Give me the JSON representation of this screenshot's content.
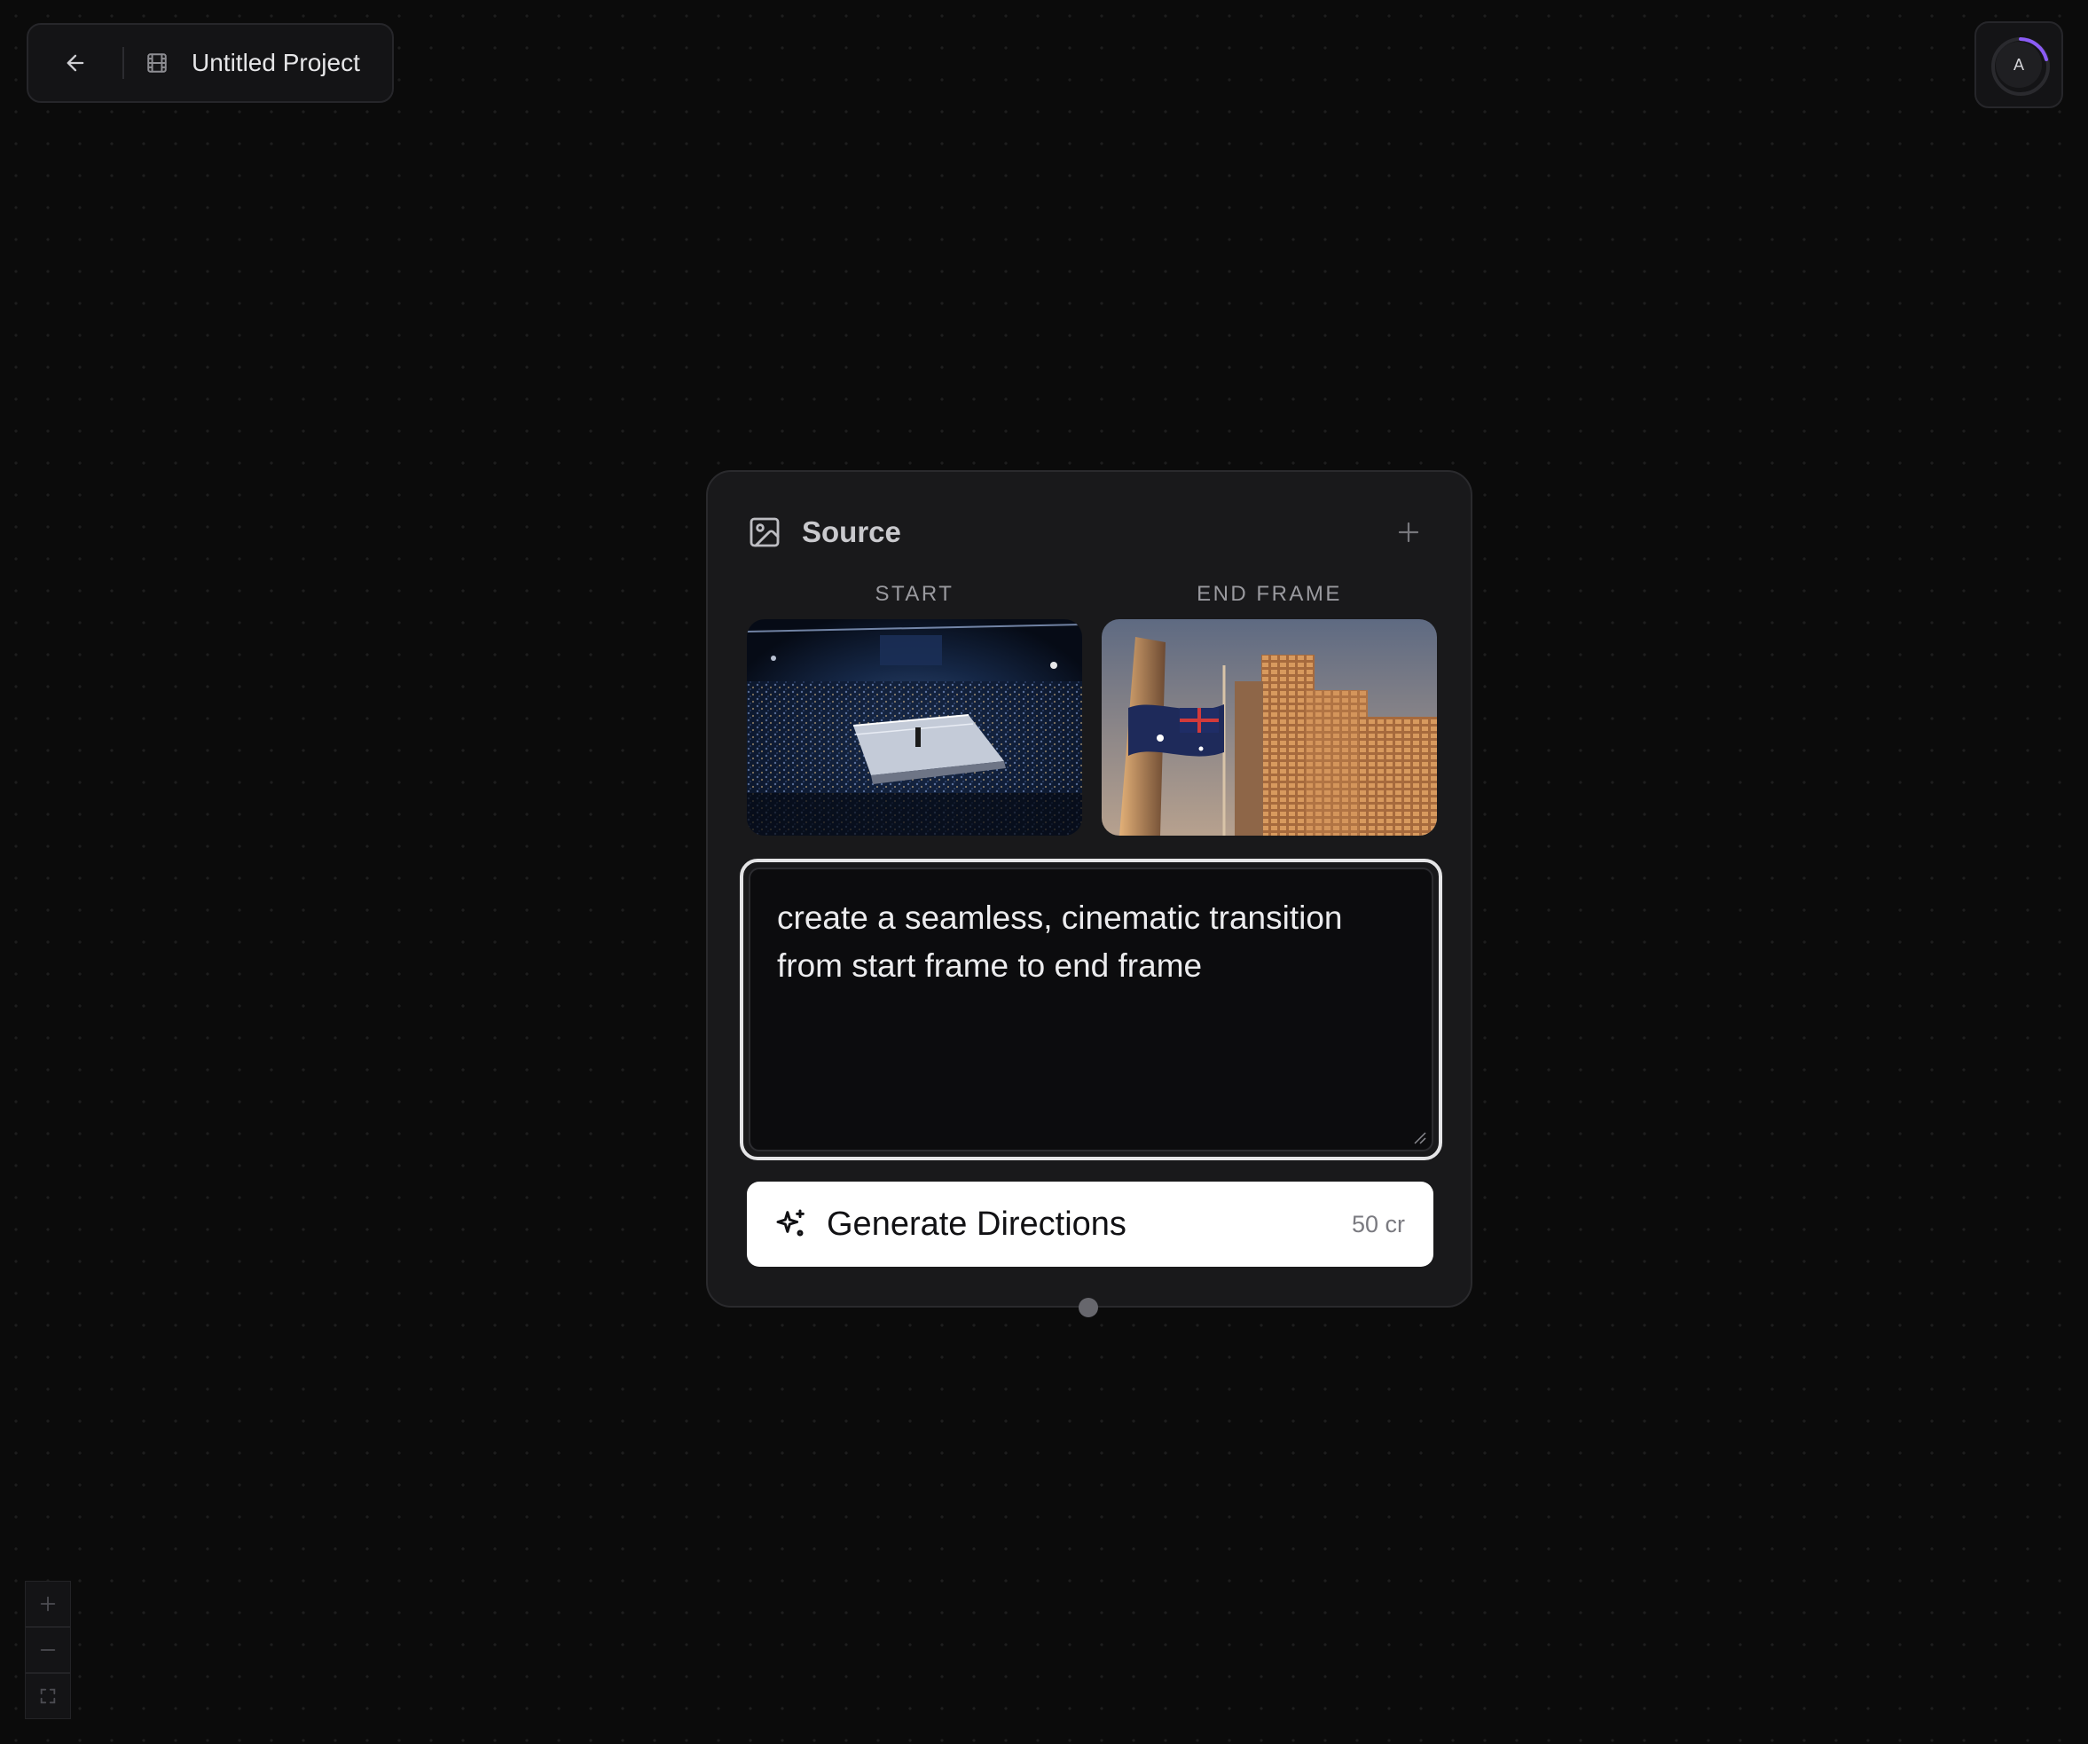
{
  "header": {
    "back_icon": "arrow-left-icon",
    "project_icon": "film-icon",
    "project_title": "Untitled Project"
  },
  "account": {
    "avatar_letter": "A",
    "progress_ring_color": "#8b5cf6"
  },
  "source_node": {
    "icon": "image-icon",
    "title": "Source",
    "add_icon": "plus-icon",
    "start_label": "START",
    "end_label": "END FRAME",
    "start_image": "boxing-arena-photo",
    "end_image": "city-flag-photo",
    "prompt_text": "create a seamless, cinematic transition from start frame to end frame",
    "generate_button": {
      "icon": "sparkles-icon",
      "label": "Generate Directions",
      "cost": "50 cr",
      "background": "#ffffff"
    }
  },
  "zoom_controls": {
    "zoom_in_icon": "plus-icon",
    "zoom_out_icon": "minus-icon",
    "fit_view_icon": "fullscreen-icon"
  }
}
